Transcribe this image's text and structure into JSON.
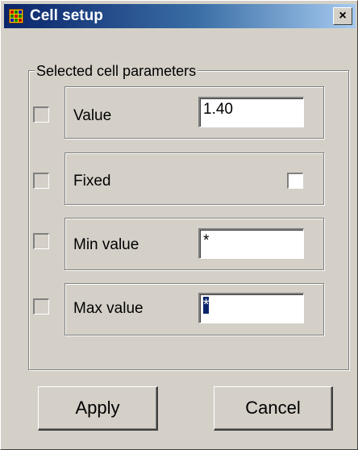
{
  "window": {
    "title": "Cell setup",
    "icon": "grid-table-icon",
    "close_label": "×"
  },
  "group": {
    "legend": "Selected cell parameters"
  },
  "rows": [
    {
      "label": "Value",
      "value": "1.40",
      "enabled": false
    },
    {
      "label": "Fixed",
      "checked": false,
      "enabled": false
    },
    {
      "label": "Min value",
      "value": "*",
      "enabled": false
    },
    {
      "label": "Max value",
      "value": "*",
      "selected": true,
      "enabled": false
    }
  ],
  "buttons": {
    "apply": "Apply",
    "cancel": "Cancel"
  },
  "colors": {
    "face": "#d4d0c8",
    "title_start": "#0a246a",
    "title_end": "#a6caf0",
    "selection": "#0a246a"
  }
}
